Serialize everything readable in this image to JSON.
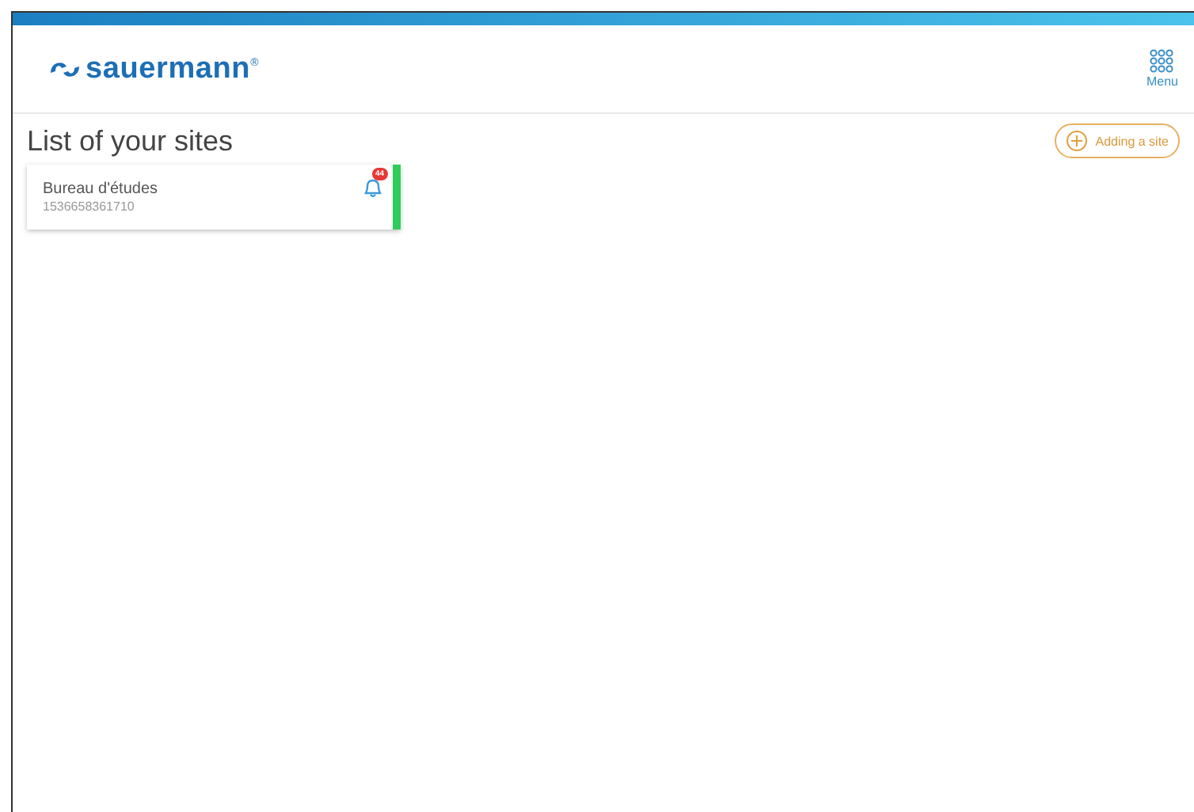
{
  "header": {
    "logo": "sauermann",
    "logo_mark": "®",
    "menu_label": "Menu"
  },
  "page": {
    "title": "List of your sites",
    "add_button": "Adding a site"
  },
  "sites": [
    {
      "name": "Bureau d'études",
      "serial": "1536658361710",
      "alerts": "44",
      "color": "#2ecc5a"
    }
  ]
}
